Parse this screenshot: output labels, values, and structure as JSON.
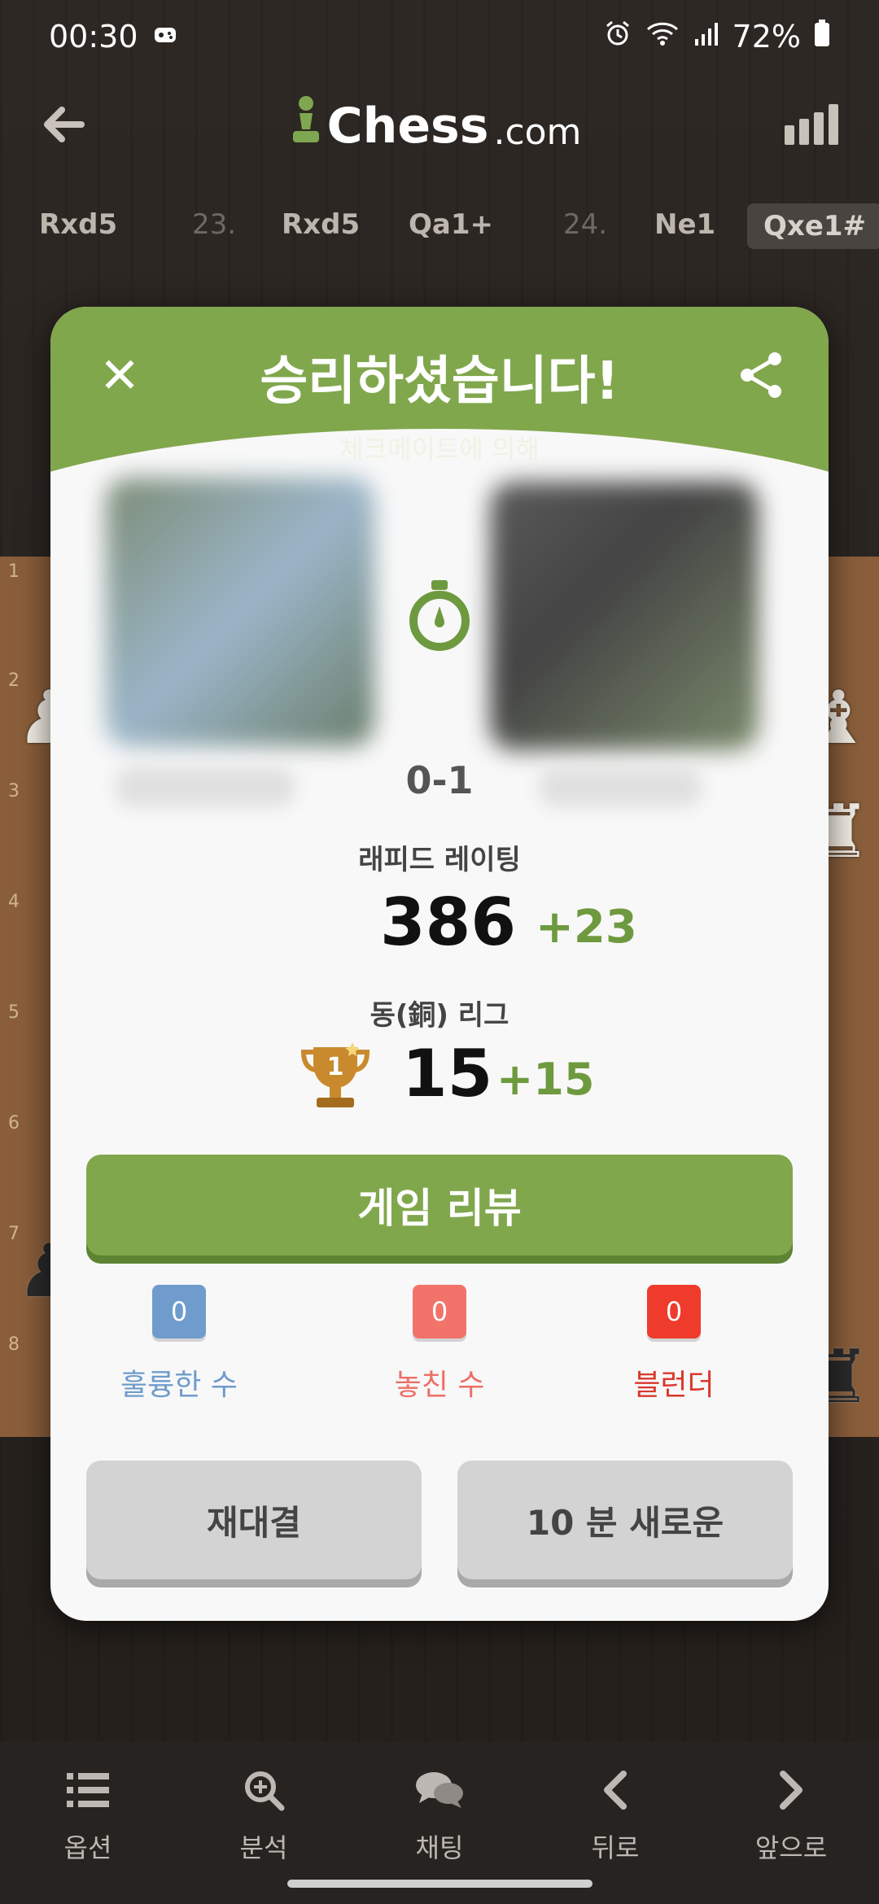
{
  "status_bar": {
    "time": "00:30",
    "battery": "72%",
    "icons": [
      "game-icon",
      "alarm-icon",
      "wifi-icon",
      "signal-icon",
      "battery-icon"
    ]
  },
  "top_bar": {
    "logo_main": "Chess",
    "logo_suffix": ".com",
    "icons": [
      "back-arrow-icon",
      "pawn-logo-icon",
      "bar-chart-icon"
    ]
  },
  "moves": {
    "m1": "Rxd5",
    "n1": "23.",
    "m2": "Rxd5",
    "m3": "Qa1+",
    "n2": "24.",
    "m4": "Ne1",
    "m5": "Qxe1#"
  },
  "board": {
    "ranks": [
      "1",
      "2",
      "3",
      "4",
      "5",
      "6",
      "7",
      "8"
    ]
  },
  "modal": {
    "title": "승리하셨습니다!",
    "subtitle": "체크메이트에 의해",
    "score": "0-1",
    "rating_label": "래피드 레이팅",
    "rating_value": "386",
    "rating_delta": "+23",
    "league_label": "동(銅) 리그",
    "league_rank": "1",
    "league_value": "15",
    "league_delta": "+15",
    "review_button": "게임 리뷰",
    "counters": [
      {
        "value": "0",
        "label": "훌륭한 수",
        "color": "#6f9ccc",
        "text_color": "#6f9ccc"
      },
      {
        "value": "0",
        "label": "놓친 수",
        "color": "#f2736a",
        "text_color": "#ec6f66"
      },
      {
        "value": "0",
        "label": "블런더",
        "color": "#ef3b2c",
        "text_color": "#d9382b"
      }
    ],
    "rematch_button": "재대결",
    "new_game_button": "10 분 새로운"
  },
  "colors": {
    "accent_green": "#81a74d",
    "delta_green": "#6e9a3f"
  },
  "bottom_nav": [
    {
      "label": "옵션",
      "icon": "list-icon"
    },
    {
      "label": "분석",
      "icon": "analysis-magnifier-icon"
    },
    {
      "label": "채팅",
      "icon": "chat-bubbles-icon"
    },
    {
      "label": "뒤로",
      "icon": "chevron-left-icon"
    },
    {
      "label": "앞으로",
      "icon": "chevron-right-icon"
    }
  ]
}
